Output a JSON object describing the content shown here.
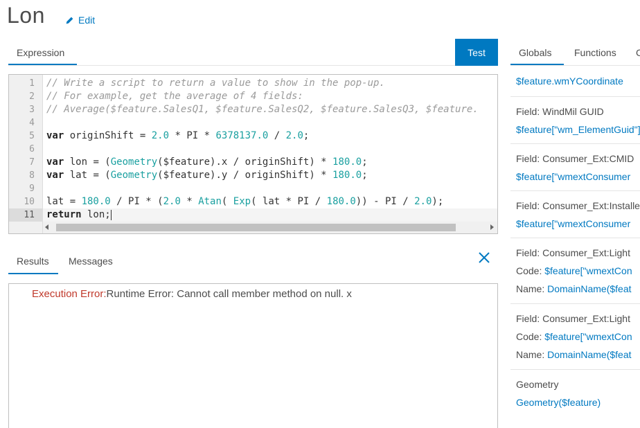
{
  "header": {
    "title": "Lon",
    "edit_label": "Edit"
  },
  "editor_panel": {
    "tab_label": "Expression",
    "test_button": "Test",
    "line_numbers": [
      "1",
      "2",
      "3",
      "4",
      "5",
      "6",
      "7",
      "8",
      "9",
      "10",
      "11"
    ],
    "current_line": "11",
    "code_lines": [
      "// Write a script to return a value to show in the pop-up.",
      "// For example, get the average of 4 fields:",
      "// Average($feature.SalesQ1, $feature.SalesQ2, $feature.SalesQ3, $feature.",
      "",
      "var originShift = 2.0 * PI * 6378137.0 / 2.0;",
      "",
      "var lon = (Geometry($feature).x / originShift) * 180.0;",
      "var lat = (Geometry($feature).y / originShift) * 180.0;",
      "",
      "lat = 180.0 / PI * (2.0 * Atan( Exp( lat * PI / 180.0)) - PI / 2.0);",
      "return lon;"
    ]
  },
  "output_panel": {
    "tabs": [
      {
        "label": "Results",
        "active": true
      },
      {
        "label": "Messages",
        "active": false
      }
    ],
    "error_label": "Execution Error:",
    "error_message": "Runtime Error: Cannot call member method on null. x"
  },
  "sidebar": {
    "tabs": [
      {
        "label": "Globals",
        "active": true
      },
      {
        "label": "Functions",
        "active": false
      },
      {
        "label": "C",
        "active": false
      }
    ],
    "items": [
      {
        "lines": [
          {
            "prefix": "",
            "text": "$feature.wmYCoordinate"
          }
        ]
      },
      {
        "lines": [
          {
            "prefix": "Field: WindMil GUID",
            "text": ""
          },
          {
            "prefix": "",
            "text": "$feature[\"wm_ElementGuid\"]"
          }
        ]
      },
      {
        "lines": [
          {
            "prefix": "Field: Consumer_Ext:CMID",
            "text": ""
          },
          {
            "prefix": "",
            "text": "$feature[\"wmextConsumer"
          }
        ]
      },
      {
        "lines": [
          {
            "prefix": "Field: Consumer_Ext:Installed",
            "text": ""
          },
          {
            "prefix": "",
            "text": "$feature[\"wmextConsumer"
          }
        ]
      },
      {
        "lines": [
          {
            "prefix": "Field: Consumer_Ext:Light",
            "text": ""
          },
          {
            "prefix": "Code: ",
            "text": "$feature[\"wmextCon"
          },
          {
            "prefix": "Name: ",
            "text": "DomainName($feat"
          }
        ]
      },
      {
        "lines": [
          {
            "prefix": "Field: Consumer_Ext:Light",
            "text": ""
          },
          {
            "prefix": "Code: ",
            "text": "$feature[\"wmextCon"
          },
          {
            "prefix": "Name: ",
            "text": "DomainName($feat"
          }
        ]
      },
      {
        "lines": [
          {
            "prefix": "Geometry",
            "text": ""
          },
          {
            "prefix": "",
            "text": "Geometry($feature)"
          }
        ]
      }
    ]
  },
  "colors": {
    "accent": "#0079c1",
    "error": "#c0392b",
    "number": "#1aa0a0"
  }
}
